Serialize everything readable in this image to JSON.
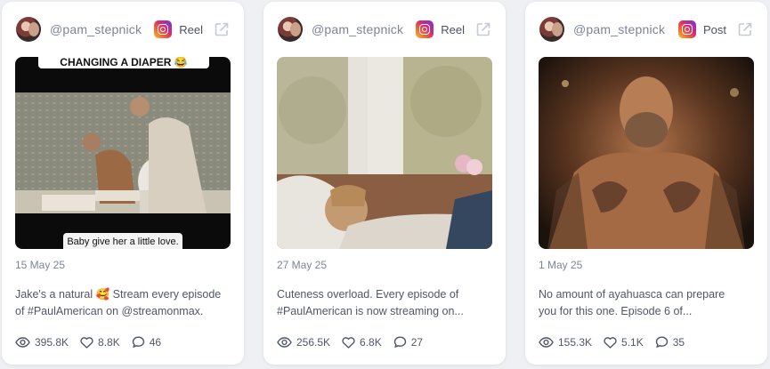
{
  "colors": {
    "page_bg": "#eef0f4",
    "card_bg": "#ffffff",
    "text": "#4f5767",
    "muted": "#7c8594"
  },
  "cards": [
    {
      "handle": "@pam_stepnick",
      "platform_icon": "instagram-icon",
      "type": "Reel",
      "overlay_top": "CHANGING A DIAPER 😂",
      "overlay_bottom": "Baby give her a little love.",
      "date": "15 May 25",
      "caption_lines": [
        "Jake's a natural 🥰 Stream every episode",
        "of #PaulAmerican on @streamonmax."
      ],
      "views": "395.8K",
      "likes": "8.8K",
      "comments": "46"
    },
    {
      "handle": "@pam_stepnick",
      "platform_icon": "instagram-icon",
      "type": "Reel",
      "date": "27 May 25",
      "caption_lines": [
        "Cuteness overload. Every episode of",
        "#PaulAmerican is now streaming on..."
      ],
      "views": "256.5K",
      "likes": "6.8K",
      "comments": "27"
    },
    {
      "handle": "@pam_stepnick",
      "platform_icon": "instagram-icon",
      "type": "Post",
      "date": "1 May 25",
      "caption_lines": [
        "No amount of ayahuasca can prepare",
        "you for this one. Episode 6 of..."
      ],
      "views": "155.3K",
      "likes": "5.1K",
      "comments": "35"
    }
  ]
}
